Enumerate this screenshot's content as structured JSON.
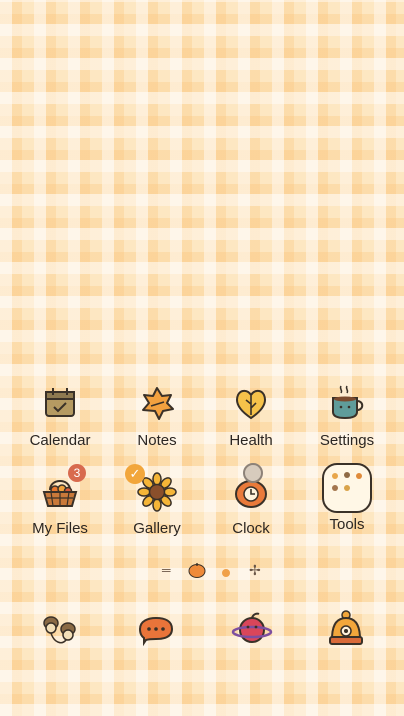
{
  "apps": [
    {
      "label": "Calendar",
      "icon": "calendar-icon"
    },
    {
      "label": "Notes",
      "icon": "leaf-icon"
    },
    {
      "label": "Health",
      "icon": "heart-leaf-icon"
    },
    {
      "label": "Settings",
      "icon": "teacup-icon"
    },
    {
      "label": "My Files",
      "icon": "basket-icon",
      "badge": "3"
    },
    {
      "label": "Gallery",
      "icon": "sunflower-icon"
    },
    {
      "label": "Clock",
      "icon": "pumpkin-clock-icon"
    },
    {
      "label": "Tools",
      "icon": "folder-icon"
    }
  ],
  "status": {
    "gallery_check": "✓"
  },
  "dock": [
    {
      "icon": "acorns-icon"
    },
    {
      "icon": "speech-bubble-icon"
    },
    {
      "icon": "apple-planet-icon"
    },
    {
      "icon": "beanie-icon"
    }
  ],
  "colors": {
    "background": "#fde7c2",
    "accent": "#f2a63b",
    "badge": "#d86a4e"
  }
}
